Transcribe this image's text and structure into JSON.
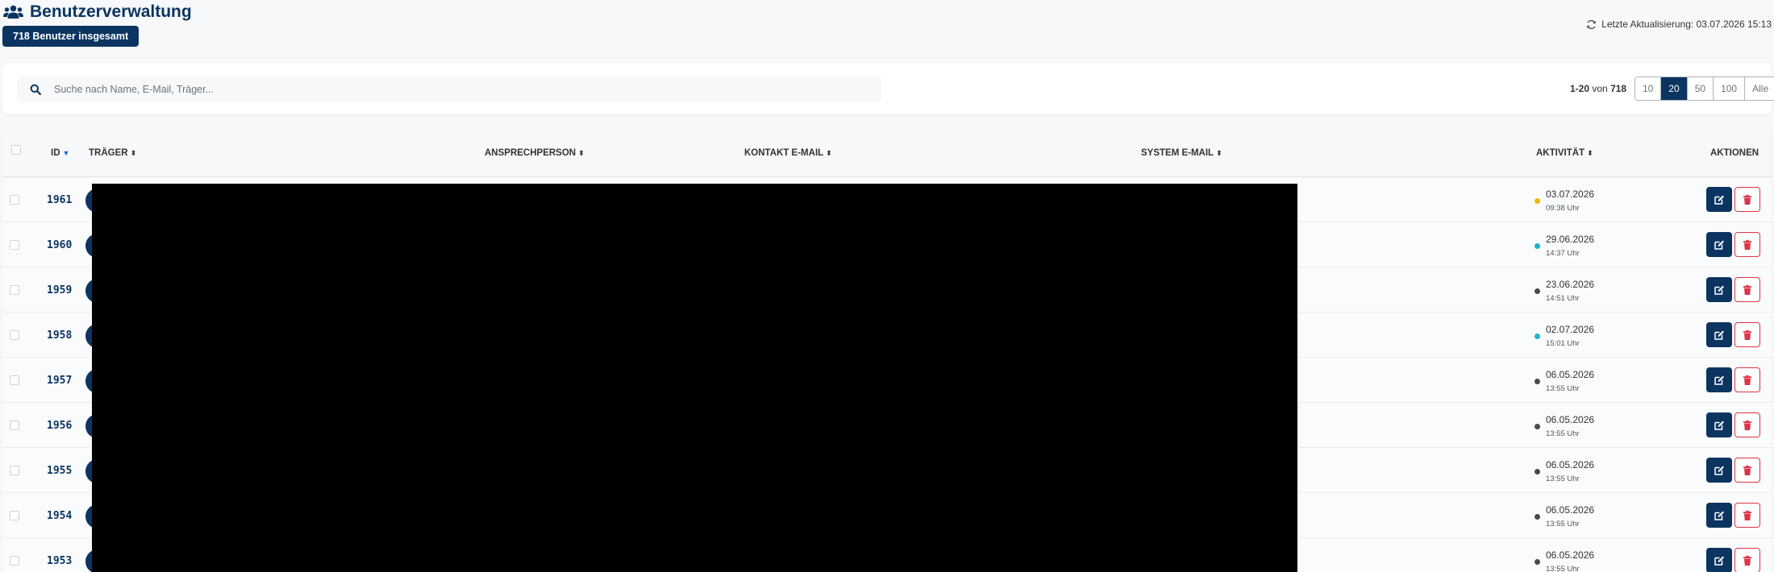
{
  "header": {
    "title": "Benutzerverwaltung",
    "total_badge": "718 Benutzer insgesamt",
    "last_update": "Letzte Aktualisierung: 03.07.2026 15:13",
    "title_icon": "users-icon",
    "refresh_icon": "refresh-icon"
  },
  "search": {
    "placeholder": "Suche nach Name, E-Mail, Träger...",
    "value": ""
  },
  "pagination": {
    "range": "1-20",
    "of_label": "von",
    "total": "718",
    "page_sizes": [
      "10",
      "20",
      "50",
      "100",
      "Alle"
    ],
    "selected_page_size": "20"
  },
  "table": {
    "columns": {
      "id": "ID",
      "traeger": "TRÄGER",
      "ansprechperson": "ANSPRECHPERSON",
      "kontakt_email": "KONTAKT E-MAIL",
      "system_email": "SYSTEM E-MAIL",
      "aktivitaet": "AKTIVITÄT",
      "aktionen": "AKTIONEN"
    },
    "rows": [
      {
        "id": "1961",
        "date": "03.07.2026",
        "time": "09:38 Uhr",
        "status_color": "#f5b800"
      },
      {
        "id": "1960",
        "date": "29.06.2026",
        "time": "14:37 Uhr",
        "status_color": "#17b8c9"
      },
      {
        "id": "1959",
        "date": "23.06.2026",
        "time": "14:51 Uhr",
        "status_color": "#4a4a4a"
      },
      {
        "id": "1958",
        "date": "02.07.2026",
        "time": "15:01 Uhr",
        "status_color": "#17b8c9"
      },
      {
        "id": "1957",
        "date": "06.05.2026",
        "time": "13:55 Uhr",
        "status_color": "#4a4a4a"
      },
      {
        "id": "1956",
        "date": "06.05.2026",
        "time": "13:55 Uhr",
        "status_color": "#4a4a4a"
      },
      {
        "id": "1955",
        "date": "06.05.2026",
        "time": "13:55 Uhr",
        "status_color": "#4a4a4a"
      },
      {
        "id": "1954",
        "date": "06.05.2026",
        "time": "13:55 Uhr",
        "status_color": "#4a4a4a"
      },
      {
        "id": "1953",
        "date": "06.05.2026",
        "time": "13:55 Uhr",
        "status_color": "#4a4a4a"
      }
    ]
  },
  "colors": {
    "primary": "#0b3560",
    "danger": "#dc3545",
    "background": "#f6f8fa"
  }
}
